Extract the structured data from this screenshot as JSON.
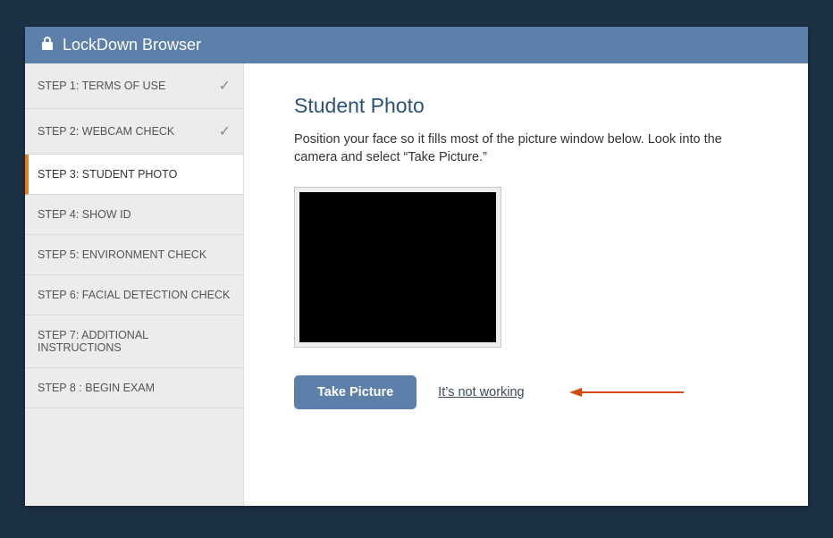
{
  "titlebar": {
    "title": "LockDown Browser"
  },
  "sidebar": {
    "steps": [
      {
        "label": "STEP 1: TERMS OF USE",
        "complete": true,
        "active": false
      },
      {
        "label": "STEP 2: WEBCAM CHECK",
        "complete": true,
        "active": false
      },
      {
        "label": "STEP 3: STUDENT PHOTO",
        "complete": false,
        "active": true
      },
      {
        "label": "STEP 4: SHOW ID",
        "complete": false,
        "active": false
      },
      {
        "label": "STEP 5: ENVIRONMENT CHECK",
        "complete": false,
        "active": false
      },
      {
        "label": "STEP 6: FACIAL DETECTION CHECK",
        "complete": false,
        "active": false
      },
      {
        "label": "STEP 7: ADDITIONAL INSTRUCTIONS",
        "complete": false,
        "active": false
      },
      {
        "label": "STEP 8 : BEGIN EXAM",
        "complete": false,
        "active": false
      }
    ]
  },
  "content": {
    "heading": "Student Photo",
    "instructions": "Position your face so it fills most of the picture window below. Look into the camera and select “Take Picture.”",
    "take_picture_label": "Take Picture",
    "not_working_label": "It’s not working"
  }
}
